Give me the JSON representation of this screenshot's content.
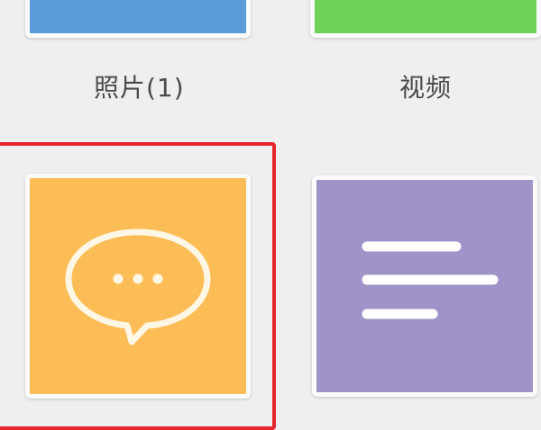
{
  "grid": {
    "tiles": [
      {
        "label": "照片(1)",
        "icon": "photo-icon",
        "color": "#5b9bd8"
      },
      {
        "label": "视频",
        "icon": "video-icon",
        "color": "#6fd158"
      },
      {
        "label": "",
        "icon": "message-bubble-icon",
        "color": "#fdbd56",
        "selected": true
      },
      {
        "label": "",
        "icon": "document-lines-icon",
        "color": "#9f93c7"
      }
    ]
  },
  "selection_color": "#e8262e"
}
